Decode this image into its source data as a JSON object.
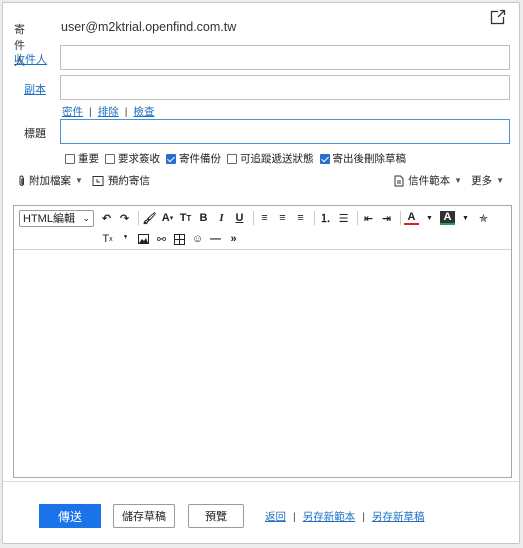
{
  "from": {
    "label": "寄件人",
    "value": "user@m2ktrial.openfind.com.tw"
  },
  "fields": {
    "to_label": "收件人",
    "cc_label": "副本",
    "subject_label": "標題"
  },
  "subtabs": {
    "bcc": "密件",
    "sort": "排除",
    "check": "檢查"
  },
  "options": [
    {
      "label": "重要",
      "checked": false
    },
    {
      "label": "要求簽收",
      "checked": false
    },
    {
      "label": "寄件備份",
      "checked": true
    },
    {
      "label": "可追蹤遞送狀態",
      "checked": false
    },
    {
      "label": "寄出後刪除草稿",
      "checked": true
    }
  ],
  "attach": {
    "attach_label": "附加檔案",
    "schedule_label": "預約寄信"
  },
  "right_tools": {
    "template_label": "信件範本",
    "more_label": "更多"
  },
  "editor": {
    "format_select": "HTML編輯"
  },
  "footer": {
    "send": "傳送",
    "save_draft": "儲存草稿",
    "preview": "預覽",
    "back": "返回",
    "save_template": "另存新範本",
    "save_new_draft": "另存新草稿"
  },
  "colors": {
    "accent": "#1a73e8",
    "link": "#1d6fc1"
  }
}
